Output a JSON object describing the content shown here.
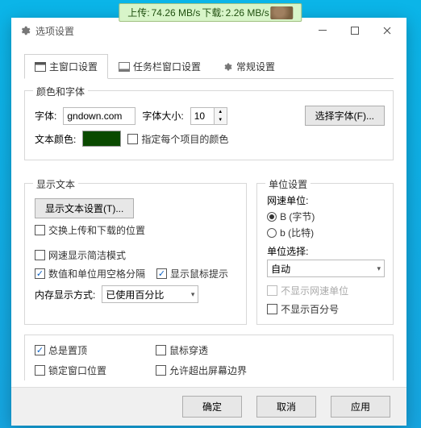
{
  "overlay": {
    "upload_label": "上传:",
    "upload_value": "74.26 MB/s",
    "download_label": "下载:",
    "download_value": "2.26 MB/s"
  },
  "window": {
    "title": "选项设置"
  },
  "tabs": {
    "main": "主窗口设置",
    "taskbar": "任务栏窗口设置",
    "general": "常规设置"
  },
  "group_font": {
    "legend": "颜色和字体",
    "font_label": "字体:",
    "font_value": "gndown.com",
    "font_size_label": "字体大小:",
    "font_size_value": "10",
    "choose_font_btn": "选择字体(F)...",
    "text_color_label": "文本颜色:",
    "color_hex": "#0a4a00",
    "specify_each_label": "指定每个项目的颜色"
  },
  "group_display": {
    "legend": "显示文本",
    "display_text_btn": "显示文本设置(T)...",
    "swap_ul_dl": "交换上传和下载的位置",
    "net_speed_simple": "网速显示简洁模式",
    "space_sep": "数值和单位用空格分隔",
    "show_tooltip": "显示鼠标提示",
    "mem_label": "内存显示方式:",
    "mem_option": "已使用百分比"
  },
  "group_unit": {
    "legend": "单位设置",
    "net_unit_label": "网速单位:",
    "radio_byte": "B (字节)",
    "radio_bit": "b (比特)",
    "unit_select_label": "单位选择:",
    "unit_option": "自动",
    "hide_net_unit": "不显示网速单位",
    "hide_percent": "不显示百分号"
  },
  "bottom": {
    "always_top": "总是置顶",
    "mouse_through": "鼠标穿透",
    "lock_position": "锁定窗口位置",
    "allow_offscreen": "允许超出屏幕边界"
  },
  "footer": {
    "ok": "确定",
    "cancel": "取消",
    "apply": "应用"
  }
}
